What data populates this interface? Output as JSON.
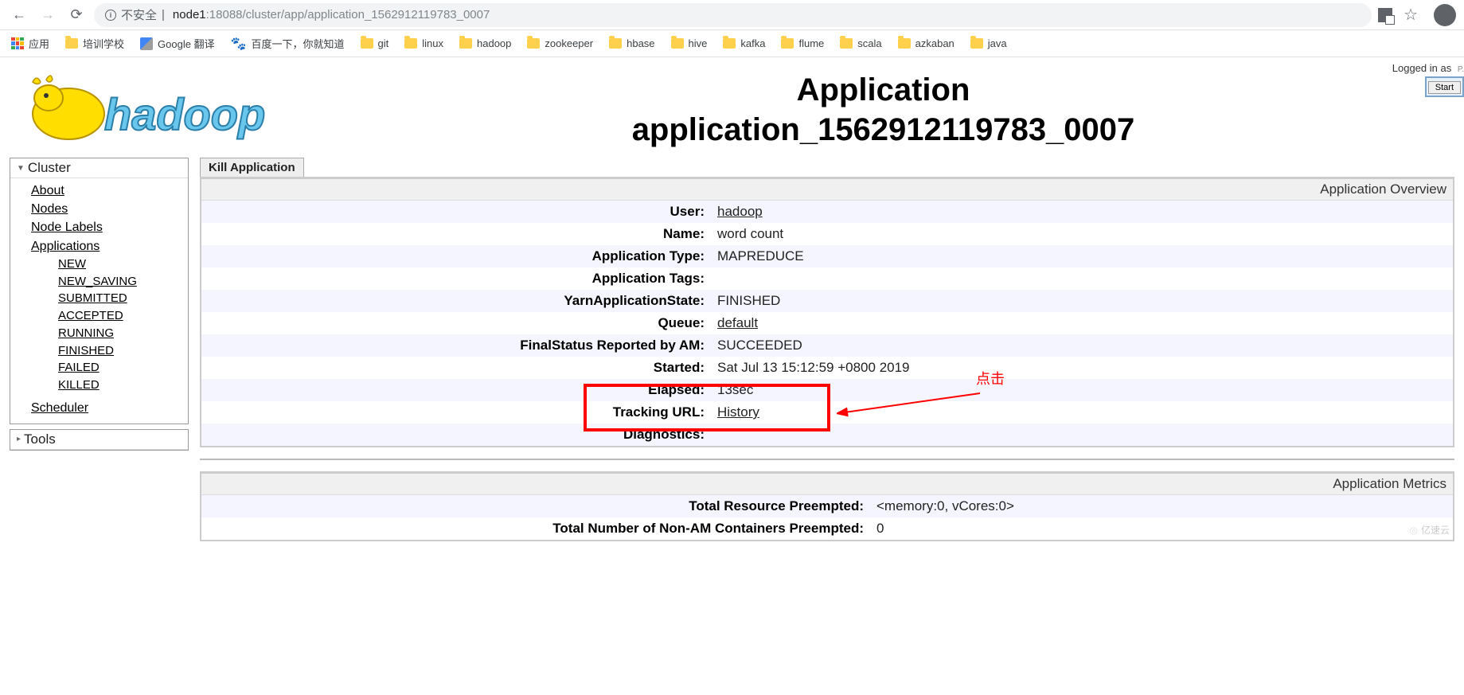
{
  "browser": {
    "security_label": "不安全",
    "url_host": "node1",
    "url_path": ":18088/cluster/app/application_1562912119783_0007",
    "apps_label": "应用"
  },
  "bookmarks": [
    {
      "label": "培训学校",
      "type": "folder"
    },
    {
      "label": "Google 翻译",
      "type": "gtrans"
    },
    {
      "label": "百度一下，你就知道",
      "type": "baidu"
    },
    {
      "label": "git",
      "type": "folder"
    },
    {
      "label": "linux",
      "type": "folder"
    },
    {
      "label": "hadoop",
      "type": "folder"
    },
    {
      "label": "zookeeper",
      "type": "folder"
    },
    {
      "label": "hbase",
      "type": "folder"
    },
    {
      "label": "hive",
      "type": "folder"
    },
    {
      "label": "kafka",
      "type": "folder"
    },
    {
      "label": "flume",
      "type": "folder"
    },
    {
      "label": "scala",
      "type": "folder"
    },
    {
      "label": "azkaban",
      "type": "folder"
    },
    {
      "label": "java",
      "type": "folder"
    }
  ],
  "header": {
    "login_text": "Logged in as",
    "start_label": "Start",
    "title_line1": "Application",
    "title_line2": "application_1562912119783_0007"
  },
  "sidebar": {
    "cluster_head": "Cluster",
    "links": {
      "about": "About",
      "nodes": "Nodes",
      "node_labels": "Node Labels",
      "applications": "Applications",
      "scheduler": "Scheduler"
    },
    "states": [
      "NEW",
      "NEW_SAVING",
      "SUBMITTED",
      "ACCEPTED",
      "RUNNING",
      "FINISHED",
      "FAILED",
      "KILLED"
    ],
    "tools_head": "Tools"
  },
  "content": {
    "kill_label": "Kill Application",
    "overview_title": "Application Overview",
    "rows": [
      {
        "k": "User:",
        "v": "hadoop",
        "link": true
      },
      {
        "k": "Name:",
        "v": "word count"
      },
      {
        "k": "Application Type:",
        "v": "MAPREDUCE"
      },
      {
        "k": "Application Tags:",
        "v": ""
      },
      {
        "k": "YarnApplicationState:",
        "v": "FINISHED"
      },
      {
        "k": "Queue:",
        "v": "default",
        "link": true
      },
      {
        "k": "FinalStatus Reported by AM:",
        "v": "SUCCEEDED"
      },
      {
        "k": "Started:",
        "v": "Sat Jul 13 15:12:59 +0800 2019"
      },
      {
        "k": "Elapsed:",
        "v": "13sec"
      },
      {
        "k": "Tracking URL:",
        "v": "History",
        "link": true
      },
      {
        "k": "Diagnostics:",
        "v": ""
      }
    ],
    "metrics_title": "Application Metrics",
    "metrics_rows": [
      {
        "k": "Total Resource Preempted:",
        "v": "<memory:0, vCores:0>"
      },
      {
        "k": "Total Number of Non-AM Containers Preempted:",
        "v": "0"
      }
    ]
  },
  "annotation": {
    "label": "点击"
  },
  "watermark": "亿速云"
}
